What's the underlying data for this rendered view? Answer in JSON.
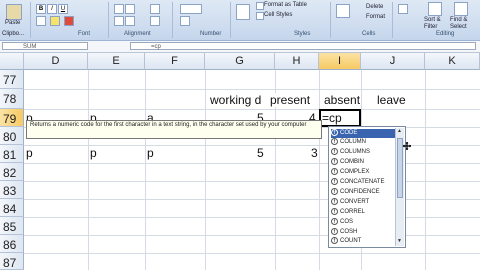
{
  "ribbon": {
    "paste_label": "Paste",
    "clipboard_label": "Clipbo...",
    "font_label": "Font",
    "alignment_label": "Alignment",
    "number_label": "Number",
    "styles_label": "Styles",
    "cells_label": "Cells",
    "editing_label": "Editing",
    "format_as_table": "Format as Table",
    "cell_styles": "Cell Styles",
    "delete_label": "Delete",
    "format_label": "Format",
    "sort_filter": "Sort & Filter",
    "find_select": "Find & Select"
  },
  "formula_bar": {
    "name_box": "SUM",
    "formula": "=cp"
  },
  "columns": [
    "D",
    "E",
    "F",
    "G",
    "H",
    "I",
    "J",
    "K"
  ],
  "selected_column": "I",
  "rows": [
    "77",
    "78",
    "79",
    "80",
    "81",
    "82",
    "83",
    "84",
    "85",
    "86",
    "87",
    "88",
    "89"
  ],
  "selected_row": "79",
  "cells": {
    "g78": "working d",
    "h78": "present",
    "i78": "absent",
    "j78": "leave",
    "d79": "p",
    "e79": "p",
    "f79": "a",
    "g79": "5",
    "h79": "4",
    "i79": "=cp",
    "d81": "p",
    "e81": "p",
    "f81": "p",
    "g81": "5",
    "h81": "3"
  },
  "tooltip": "Returns a numeric code for the first character in a text string, in the character set used by your computer",
  "autocomplete": {
    "selected": "CODE",
    "items": [
      "CODE",
      "COLUMN",
      "COLUMNS",
      "COMBIN",
      "COMPLEX",
      "CONCATENATE",
      "CONFIDENCE",
      "CONVERT",
      "CORREL",
      "COS",
      "COSH",
      "COUNT"
    ]
  },
  "colors": {
    "ribbon": "#c5d6ec",
    "selected_header": "#f6c963",
    "autocomplete_highlight": "#3a64b0"
  }
}
